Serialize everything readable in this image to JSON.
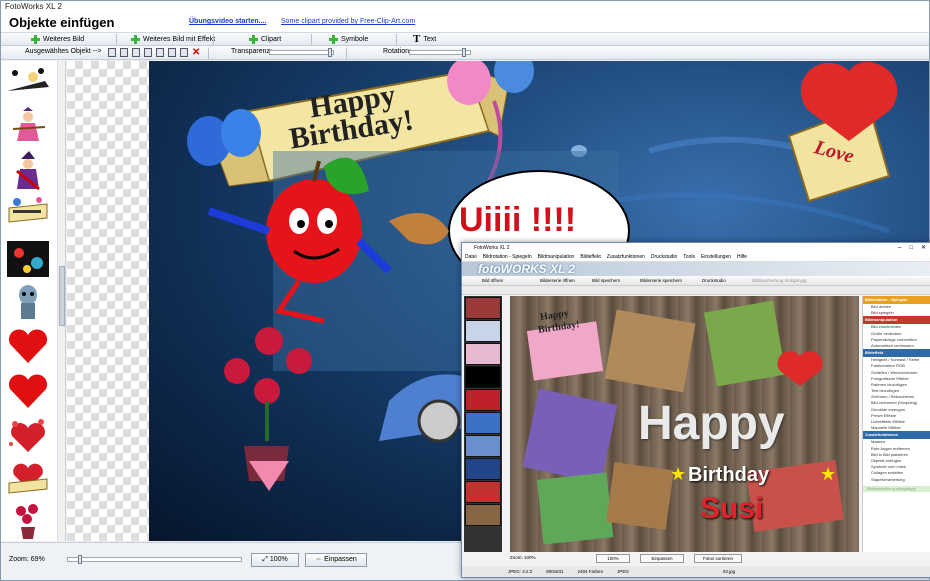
{
  "window": {
    "title": "FotoWorks XL 2"
  },
  "header": {
    "title": "Objekte einfügen",
    "video_link": "Übungsvideo starten....",
    "credit": "Some clipart provided by Free-Clip-Art.com"
  },
  "toolbar": {
    "more_image": "Weiteres Bild",
    "more_image_effect": "Weiteres Bild mit Effekt",
    "clipart": "Clipart",
    "symbols": "Symbole",
    "text": "Text"
  },
  "toolbar2": {
    "selected_object": "Ausgewähltes Objekt -->",
    "transparency": "Transparenz:",
    "rotation": "Rotation:"
  },
  "canvas_text": {
    "banner_line1": "Happy",
    "banner_line2": "Birthday!",
    "love": "Love",
    "speech": "Uiiii !!!!"
  },
  "statusbar": {
    "zoom": "Zoom: 69%",
    "btn_100": "100%",
    "btn_fit": "Einpassen"
  },
  "inner_window": {
    "title": "FotoWorks XL 2",
    "menu": [
      "Datei",
      "Bildrotation - Spiegeln",
      "Bildmanipulation",
      "Bildeffekt",
      "Zusatzfunktionen",
      "Druckstudio",
      "Tools",
      "Einstellungen",
      "Hilfe"
    ],
    "logo": "fotoWORKS XL 2",
    "tools": [
      "Bild öffnen",
      "Bilderserie öffnen",
      "Bild speichern",
      "Bilderserie speichern",
      "Druckstudio",
      "Bildbearbeitung rückgängig"
    ],
    "canvas_text": {
      "happy": "Happy",
      "birthday": "Birthday",
      "name": "Susi",
      "small_happy": "Happy",
      "small_birthday": "Birthday!"
    },
    "panel": {
      "sections": [
        {
          "title": "Bildrotation - Spiegeln",
          "color": "#e8a020",
          "items": [
            "Bild drehen",
            "Bild spiegeln"
          ]
        },
        {
          "title": "Bildmanipulation",
          "color": "#c0392b",
          "items": [
            "Bild zuschneiden",
            "Größe verändern",
            "Papierabzüge vorbereiten",
            "Automatisch verbessern"
          ]
        },
        {
          "title": "Bildeffekt",
          "color": "#2f6aa8",
          "items": [
            "Helligkeit / Kontrast / Farbe",
            "Farbkorrektur RGB",
            "Schärfen / Weichzeichnen",
            "Fotografische Effekte",
            "Rahmen hinzufügen",
            "Text hinzufügen",
            "Zeichnen / Retuschieren",
            "Bild verformen (Morphing)",
            "Gemälde erzeugen",
            "Preset Effekte",
            "Lichteffekte Effekte",
            "Manuelle Effekte"
          ]
        },
        {
          "title": "Zusatzfunktionen",
          "color": "#2f6aa8",
          "items": [
            "Masken",
            "Rote Augen entfernen",
            "Bild in Bild platzieren",
            "Objekte einfügen",
            "Symbole und Linien",
            "Collagen erstellen",
            "Stapelverarbeitung"
          ]
        }
      ],
      "undo": "Bildbearbeitung rückgängig"
    },
    "bottom": {
      "zoom": "Zoom: 100%",
      "btn_100": "100%",
      "btn_fit": "Einpassen",
      "btn_rotate": "Fotos sortieren"
    },
    "status": {
      "format": "JPEG: 4:2:2",
      "size": "800x531",
      "colors": "2484 Farben",
      "type": "JPEG",
      "file": "03.jpg"
    }
  },
  "colors": {
    "accent": "#3bb43b",
    "link": "#1a3ccc",
    "sky_dark": "#0c2444"
  }
}
